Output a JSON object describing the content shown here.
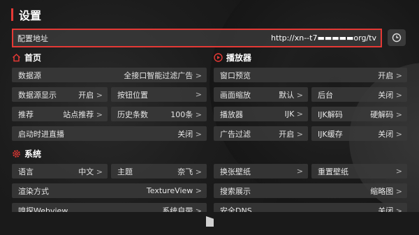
{
  "header": {
    "title": "设置"
  },
  "config": {
    "label": "配置地址",
    "url": "http://xn--t7▬▬▬▬▬org/tv"
  },
  "sections": {
    "home": "首页",
    "player": "播放器",
    "system": "系统"
  },
  "rows": {
    "data_source": {
      "label": "数据源",
      "value": "全接口智能过滤广告"
    },
    "data_source_display": {
      "label": "数据源显示",
      "value": "开启"
    },
    "button_position": {
      "label": "按钮位置",
      "value": ""
    },
    "recommend": {
      "label": "推荐",
      "value": "站点推荐"
    },
    "history_count": {
      "label": "历史条数",
      "value": "100条"
    },
    "startup_live": {
      "label": "启动时进直播",
      "value": "关闭"
    },
    "window_preview": {
      "label": "窗口预览",
      "value": "开启"
    },
    "screen_scale": {
      "label": "画面缩放",
      "value": "默认"
    },
    "background": {
      "label": "后台",
      "value": "关闭"
    },
    "player": {
      "label": "播放器",
      "value": "IJK"
    },
    "ijk_decode": {
      "label": "IJK解码",
      "value": "硬解码"
    },
    "ad_filter": {
      "label": "广告过滤",
      "value": "开启"
    },
    "ijk_cache": {
      "label": "IJK缓存",
      "value": "关闭"
    },
    "language": {
      "label": "语言",
      "value": "中文"
    },
    "theme": {
      "label": "主题",
      "value": "奈飞"
    },
    "change_wallpaper": {
      "label": "换张壁纸",
      "value": ""
    },
    "reset_wallpaper": {
      "label": "重置壁纸",
      "value": ""
    },
    "render_mode": {
      "label": "渲染方式",
      "value": "TextureView"
    },
    "search_display": {
      "label": "搜索展示",
      "value": "缩略图"
    },
    "sniff_webview": {
      "label": "嗅探Webview",
      "value": "系统自带"
    },
    "secure_dns": {
      "label": "安全DNS",
      "value": "关闭"
    }
  },
  "colors": {
    "accent": "#e53935",
    "cell": "#3a3a3a",
    "background": "#161616"
  }
}
